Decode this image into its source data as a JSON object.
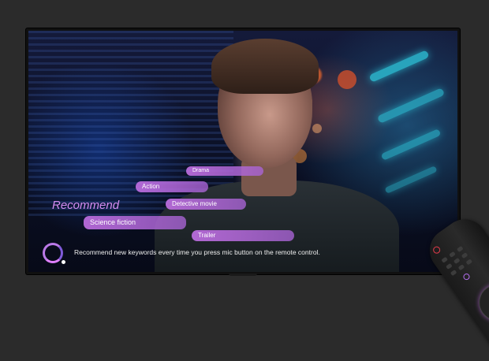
{
  "overlay": {
    "heading": "Recommend",
    "keywords": [
      "Drama",
      "Action",
      "Detective movie",
      "Science fiction",
      "Trailer"
    ],
    "info_text": "Recommend new keywords every time you press mic button on the remote control."
  },
  "colors": {
    "accent": "#d58df2",
    "chip": "#be6ee1",
    "background": "#2b2b2b",
    "power": "#e43b4c"
  }
}
